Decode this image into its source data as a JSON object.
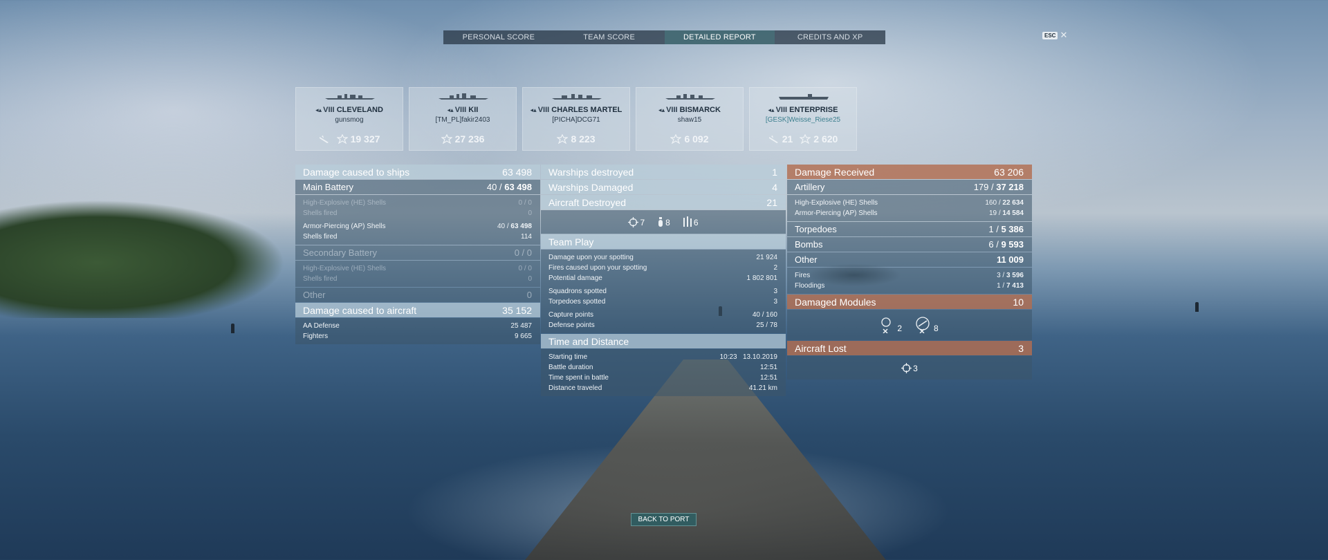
{
  "tabs": [
    "PERSONAL SCORE",
    "TEAM SCORE",
    "DETAILED REPORT",
    "CREDITS AND XP"
  ],
  "active_tab": "DETAILED REPORT",
  "esc_key": "ESC",
  "ships": [
    {
      "tier": "VIII",
      "name": "CLEVELAND",
      "player": "gunsmog",
      "stat1": "19 327",
      "stat1_icon": "xp-icon",
      "lead_icon": "plane-icon"
    },
    {
      "tier": "VIII",
      "name": "KII",
      "player": "[TM_PL]fakir2403",
      "stat1": "27 236",
      "stat1_icon": "xp-icon"
    },
    {
      "tier": "VIII",
      "name": "CHARLES MARTEL",
      "player": "[PICHA]DCG71",
      "stat1": "8 223",
      "stat1_icon": "xp-icon"
    },
    {
      "tier": "VIII",
      "name": "BISMARCK",
      "player": "shaw15",
      "stat1": "6 092",
      "stat1_icon": "xp-icon"
    },
    {
      "tier": "VIII",
      "name": "ENTERPRISE",
      "player": "[GESK]Weisse_Riese25",
      "stat0": "21",
      "stat1": "2 620",
      "stat1_icon": "xp-icon",
      "lead_icon": "plane-icon"
    }
  ],
  "damage_ships": {
    "label": "Damage caused to ships",
    "value": "63 498",
    "main_battery": {
      "label": "Main Battery",
      "count": "40",
      "total": "63 498"
    },
    "mb_he": {
      "label": "High-Explosive (HE) Shells",
      "value": "0 / 0"
    },
    "mb_he_fired": {
      "label": "Shells fired",
      "value": "0"
    },
    "mb_ap": {
      "label": "Armor-Piercing (AP) Shells",
      "count": "40",
      "total": "63 498"
    },
    "mb_ap_fired": {
      "label": "Shells fired",
      "value": "114"
    },
    "secondary": {
      "label": "Secondary Battery",
      "value": "0 / 0"
    },
    "sb_he": {
      "label": "High-Explosive (HE) Shells",
      "value": "0 / 0"
    },
    "sb_he_fired": {
      "label": "Shells fired",
      "value": "0"
    },
    "other": {
      "label": "Other",
      "value": "0"
    }
  },
  "damage_aircraft": {
    "label": "Damage caused to aircraft",
    "value": "35 152",
    "aa": {
      "label": "AA Defense",
      "value": "25 487"
    },
    "fighters": {
      "label": "Fighters",
      "value": "9 665"
    }
  },
  "warships_destroyed": {
    "label": "Warships destroyed",
    "value": "1"
  },
  "warships_damaged": {
    "label": "Warships Damaged",
    "value": "4"
  },
  "aircraft_destroyed": {
    "label": "Aircraft Destroyed",
    "value": "21",
    "types": [
      "7",
      "8",
      "6"
    ]
  },
  "team_play": {
    "label": "Team Play",
    "rows": [
      {
        "label": "Damage upon your spotting",
        "value": "21 924"
      },
      {
        "label": "Fires caused upon your spotting",
        "value": "2"
      },
      {
        "label": "Potential damage",
        "value": "1 802 801"
      },
      {
        "label": "Squadrons spotted",
        "value": "3"
      },
      {
        "label": "Torpedoes spotted",
        "value": "3"
      },
      {
        "label": "Capture points",
        "value": "40 / 160"
      },
      {
        "label": "Defense points",
        "value": "25 / 78"
      }
    ]
  },
  "time_distance": {
    "label": "Time and Distance",
    "rows": [
      {
        "label": "Starting time",
        "value": "10:23   13.10.2019"
      },
      {
        "label": "Battle duration",
        "value": "12:51"
      },
      {
        "label": "Time spent in battle",
        "value": "12:51"
      },
      {
        "label": "Distance traveled",
        "value": "41.21 km"
      }
    ]
  },
  "damage_received": {
    "label": "Damage Received",
    "value": "63 206",
    "artillery": {
      "label": "Artillery",
      "count": "179",
      "total": "37 218"
    },
    "art_he": {
      "label": "High-Explosive (HE) Shells",
      "count": "160",
      "total": "22 634"
    },
    "art_ap": {
      "label": "Armor-Piercing (AP) Shells",
      "count": "19",
      "total": "14 584"
    },
    "torpedoes": {
      "label": "Torpedoes",
      "count": "1",
      "total": "5 386"
    },
    "bombs": {
      "label": "Bombs",
      "count": "6",
      "total": "9 593"
    },
    "other": {
      "label": "Other",
      "value": "11 009"
    },
    "fires": {
      "label": "Fires",
      "count": "3",
      "total": "3 596"
    },
    "floodings": {
      "label": "Floodings",
      "count": "1",
      "total": "7 413"
    }
  },
  "damaged_modules": {
    "label": "Damaged Modules",
    "value": "10",
    "items": [
      "2",
      "8"
    ]
  },
  "aircraft_lost": {
    "label": "Aircraft Lost",
    "value": "3",
    "items": [
      "3"
    ]
  },
  "back_button": "BACK TO PORT",
  "colors": {
    "received_header": "#b26e50",
    "active_tab": "#466e78"
  }
}
